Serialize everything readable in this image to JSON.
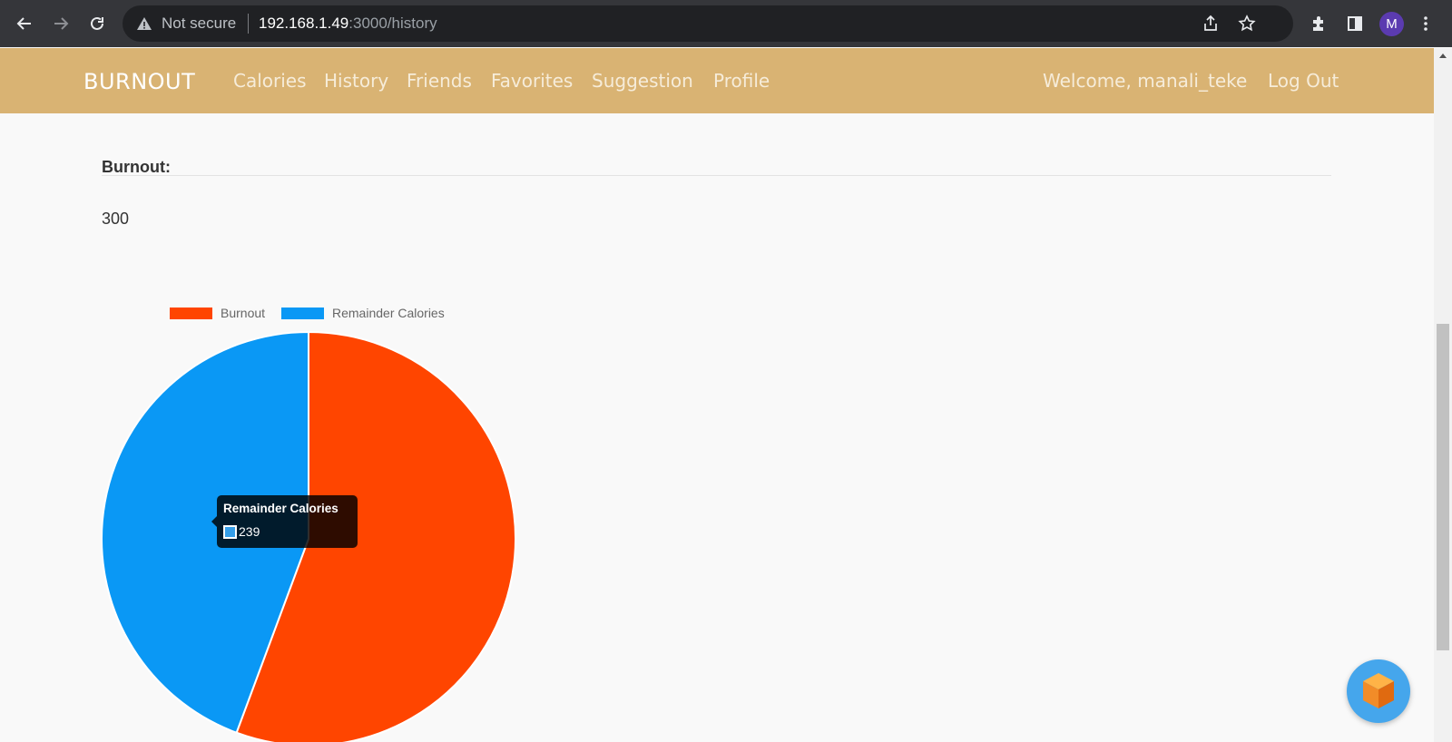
{
  "browser": {
    "security_text": "Not secure",
    "url_host": "192.168.1.49",
    "url_path": ":3000/history",
    "profile_initial": "M",
    "icons": [
      "back-arrow-icon",
      "forward-arrow-icon",
      "reload-icon",
      "warning-icon",
      "share-icon",
      "star-icon",
      "extensions-icon",
      "side-panel-icon",
      "menu-dots-icon"
    ]
  },
  "navbar": {
    "brand": "BURNOUT",
    "links": [
      "Calories",
      "History",
      "Friends",
      "Favorites",
      "Suggestion",
      "Profile"
    ],
    "welcome": "Welcome, manali_teke",
    "logout": "Log Out",
    "background_color": "#d9b373"
  },
  "content": {
    "label": "Burnout:",
    "value": "300"
  },
  "chart_data": {
    "type": "pie",
    "categories": [
      "Burnout",
      "Remainder Calories"
    ],
    "values": [
      300,
      239
    ],
    "colors": [
      "#ff4500",
      "#0a98f5"
    ],
    "legend": "top",
    "tooltip": {
      "title": "Remainder Calories",
      "value": "239"
    }
  },
  "fab": {
    "icon": "cube-icon",
    "color": "#45a6ec"
  }
}
